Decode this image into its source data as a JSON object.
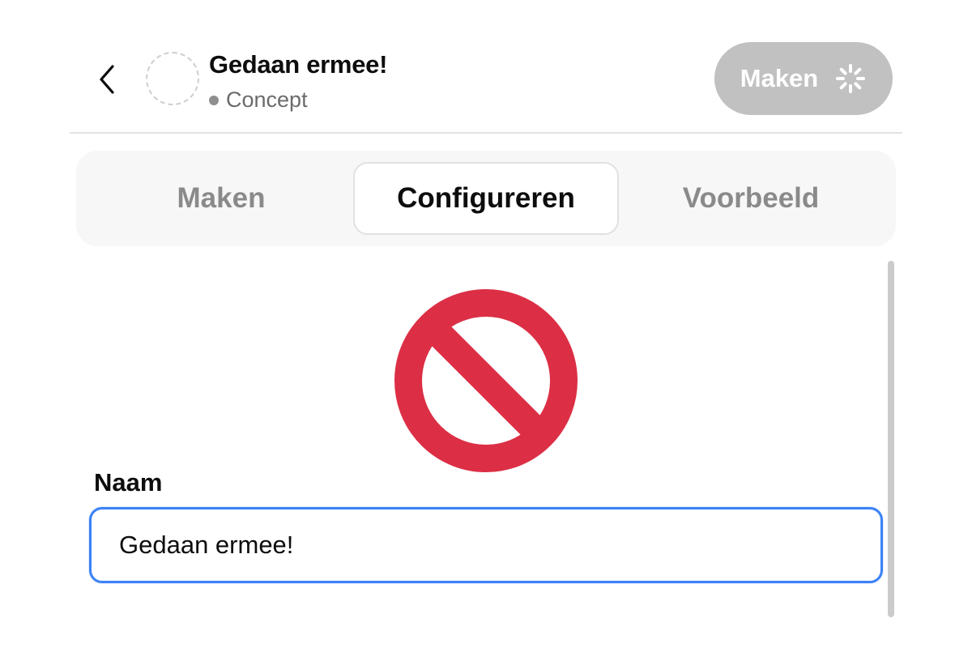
{
  "header": {
    "back_icon": "chevron-left-icon",
    "gpt_name": "Gedaan ermee!",
    "status": "Concept",
    "create_button": {
      "label": "Maken",
      "icon": "loading-spinner-icon",
      "disabled": true
    }
  },
  "tabs": [
    {
      "label": "Maken",
      "active": false
    },
    {
      "label": "Configureren",
      "active": true
    },
    {
      "label": "Voorbeeld",
      "active": false
    }
  ],
  "overlay": {
    "icon": "prohibited-icon",
    "color": "#dc2f45"
  },
  "form": {
    "name_label": "Naam",
    "name_value": "Gedaan ermee!"
  },
  "colors": {
    "focus_border": "#3b82f6",
    "disabled_button": "#c1c1c1"
  }
}
